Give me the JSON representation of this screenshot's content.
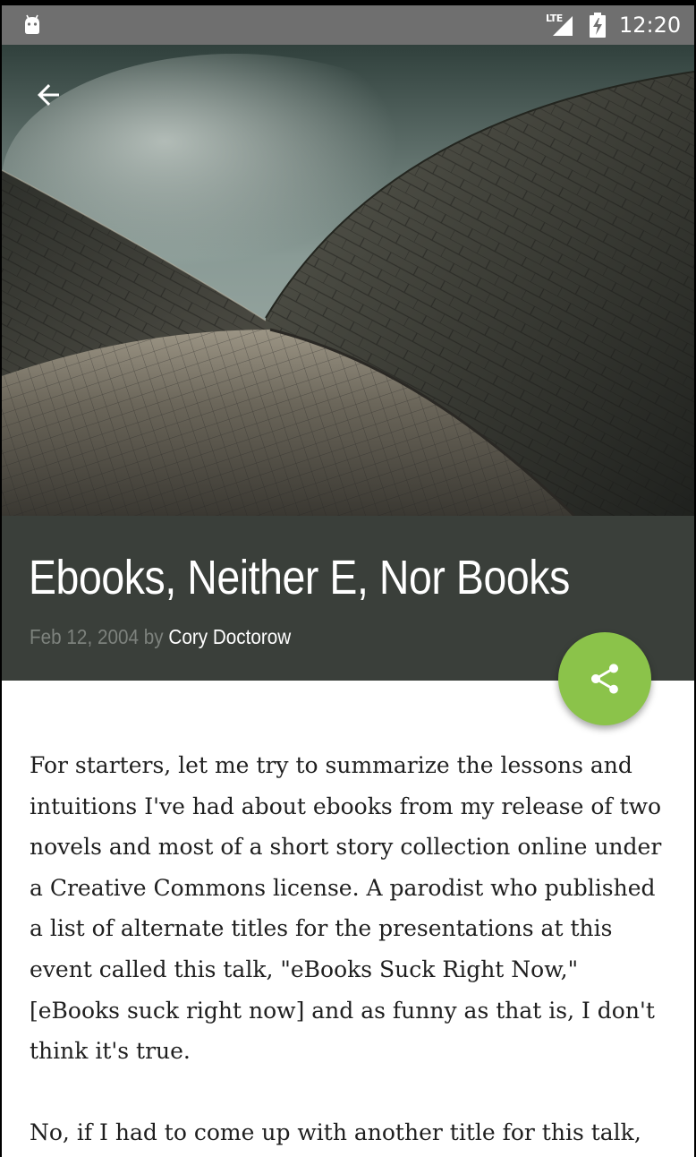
{
  "status_bar": {
    "network": "LTE",
    "time": "12:20"
  },
  "icons": {
    "status_app": "android-icon",
    "signal": "signal-icon",
    "battery": "battery-charging-icon",
    "back": "arrow-back-icon",
    "share": "share-icon"
  },
  "colors": {
    "status_bar": "#6f6f6f",
    "title_block": "#3a3f3a",
    "fab": "#8bc34a",
    "meta_muted": "#7d827d"
  },
  "article": {
    "title": "Ebooks, Neither E, Nor Books",
    "date": "Feb 12, 2004",
    "by": "by",
    "author": "Cory Doctorow",
    "paragraphs": [
      "For starters, let me try to summarize the lessons and intuitions I've had about ebooks from my release of two novels and most of a short story collection online under a Creative Commons license. A parodist who published a list of alternate titles for the presentations at this event called this talk, \"eBooks Suck Right Now,\" [eBooks suck right now] and as funny as that is, I don't think it's true.",
      "No, if I had to come up with another title for this talk,"
    ]
  }
}
